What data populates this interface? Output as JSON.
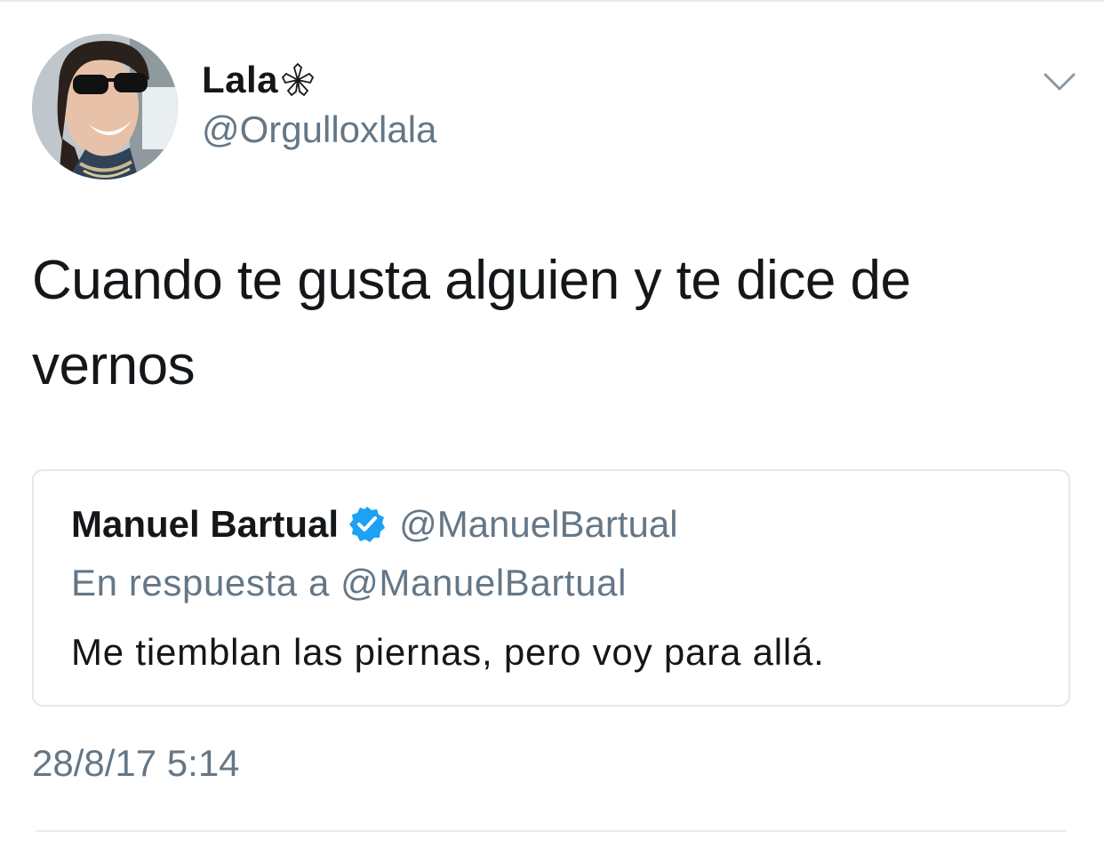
{
  "author": {
    "name": "Lala",
    "handle": "@Orgulloxlala",
    "name_emoji_icon": "flower-icon"
  },
  "tweet": {
    "text": "Cuando te gusta alguien y te dice de vernos",
    "timestamp": "28/8/17 5:14"
  },
  "quoted_tweet": {
    "name": "Manuel Bartual",
    "verified": true,
    "handle": "@ManuelBartual",
    "reply_to": "En respuesta a @ManuelBartual",
    "text": "Me tiemblan las piernas, pero voy para allá."
  },
  "colors": {
    "primary_text": "#14171a",
    "secondary_text": "#657786",
    "verified_blue": "#1da1f2",
    "border": "#e1e8ed"
  }
}
